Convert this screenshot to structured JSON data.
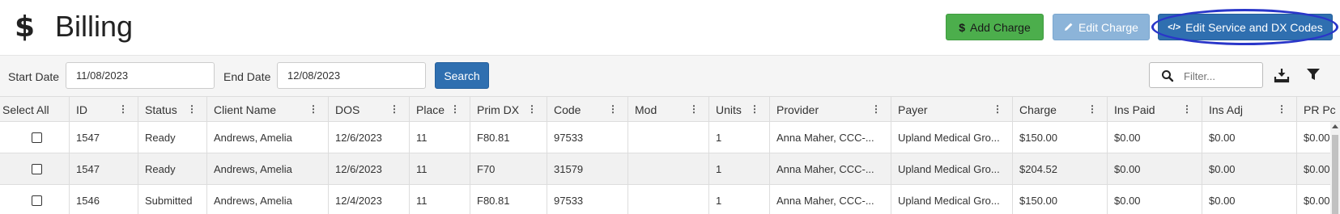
{
  "header": {
    "title": "Billing",
    "add_charge_label": "Add Charge",
    "edit_charge_label": "Edit Charge",
    "edit_codes_label": "Edit Service and DX Codes",
    "code_icon_glyph": "</>"
  },
  "toolbar": {
    "start_date_label": "Start Date",
    "start_date_value": "11/08/2023",
    "end_date_label": "End Date",
    "end_date_value": "12/08/2023",
    "search_label": "Search",
    "filter_placeholder": "Filter..."
  },
  "grid": {
    "columns": [
      "Select All",
      "ID",
      "Status",
      "Client Name",
      "DOS",
      "Place",
      "Prim DX",
      "Code",
      "Mod",
      "Units",
      "Provider",
      "Payer",
      "Charge",
      "Ins Paid",
      "Ins Adj",
      "PR Pc"
    ],
    "rows": [
      {
        "id": "1547",
        "status": "Ready",
        "client": "Andrews, Amelia",
        "dos": "12/6/2023",
        "place": "11",
        "prim_dx": "F80.81",
        "code": "97533",
        "mod": "",
        "units": "1",
        "provider": "Anna Maher, CCC-...",
        "payer": "Upland Medical Gro...",
        "charge": "$150.00",
        "ins_paid": "$0.00",
        "ins_adj": "$0.00",
        "pr_paid": "$0.00"
      },
      {
        "id": "1547",
        "status": "Ready",
        "client": "Andrews, Amelia",
        "dos": "12/6/2023",
        "place": "11",
        "prim_dx": "F70",
        "code": "31579",
        "mod": "",
        "units": "1",
        "provider": "Anna Maher, CCC-...",
        "payer": "Upland Medical Gro...",
        "charge": "$204.52",
        "ins_paid": "$0.00",
        "ins_adj": "$0.00",
        "pr_paid": "$0.00"
      },
      {
        "id": "1546",
        "status": "Submitted",
        "client": "Andrews, Amelia",
        "dos": "12/4/2023",
        "place": "11",
        "prim_dx": "F80.81",
        "code": "97533",
        "mod": "",
        "units": "1",
        "provider": "Anna Maher, CCC-...",
        "payer": "Upland Medical Gro...",
        "charge": "$150.00",
        "ins_paid": "$0.00",
        "ins_adj": "$0.00",
        "pr_paid": "$0.00"
      }
    ]
  },
  "icons": {
    "title": "dollar-icon",
    "add_charge": "dollar-icon",
    "edit_charge": "pencil-icon",
    "edit_codes": "code-icon",
    "filter_search": "search-icon",
    "download": "download-icon",
    "filter": "filter-icon"
  },
  "colors": {
    "add_charge": "#4cae4c",
    "edit_charge": "#8cb4d9",
    "primary": "#2f6fb0",
    "highlight_ring": "#2a36c9"
  }
}
